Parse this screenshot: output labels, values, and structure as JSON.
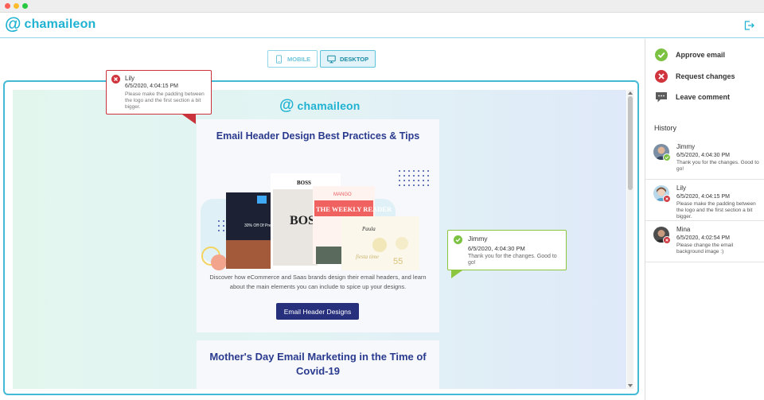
{
  "app": {
    "logo_symbol": "@",
    "logo_text": "chamaileon",
    "brand_color": "#1fb2d2",
    "exit_icon": "logout-icon"
  },
  "view_toggle": {
    "mobile_label": "MOBILE",
    "desktop_label": "DESKTOP",
    "selected": "DESKTOP"
  },
  "preview": {
    "email_logo_symbol": "@",
    "email_logo_text": "chamaileon",
    "card1": {
      "title": "Email Header Design Best Practices & Tips",
      "description": "Discover how eCommerce and Saas brands design their email headers, and learn about the main elements you can include to spice up your designs.",
      "button": "Email Header Designs",
      "collage": {
        "boss": "BOSS",
        "boss_big": "BOS",
        "mango": "MANGO",
        "weekly": "THE WEEKLY READER",
        "promo": "30% Off Of Premium Mem",
        "paula": "Paula",
        "fiesta": "fiesta time",
        "number": "55"
      }
    },
    "card2": {
      "title": "Mother's Day Email Marketing in the Time of Covid-19"
    }
  },
  "comments": {
    "lily": {
      "name": "Lily",
      "time": "6/5/2020, 4:04:15 PM",
      "message": "Please make the padding between the logo and the first section a bit bigger.",
      "status": "rejected",
      "color": "#c9343c"
    },
    "jimmy": {
      "name": "Jimmy",
      "time": "6/5/2020, 4:04:30 PM",
      "message": "Thank you for the changes. Good to go!",
      "status": "approved",
      "color": "#8cc63f"
    }
  },
  "sidebar": {
    "actions": [
      {
        "label": "Approve email",
        "icon": "check-circle-icon",
        "color": "#7cc242"
      },
      {
        "label": "Request changes",
        "icon": "x-circle-icon",
        "color": "#d0353d"
      },
      {
        "label": "Leave comment",
        "icon": "comment-icon",
        "color": "#5b5b5b"
      }
    ],
    "history_title": "History",
    "history": [
      {
        "name": "Jimmy",
        "time": "6/5/2020, 4:04:30 PM",
        "message": "Thank you for the changes. Good to go!",
        "status": "approved"
      },
      {
        "name": "Lily",
        "time": "6/5/2020, 4:04:15 PM",
        "message": "Please make the padding between the logo and the first section a bit bigger.",
        "status": "rejected"
      },
      {
        "name": "Mina",
        "time": "6/5/2020, 4:02:54 PM",
        "message": "Please change the email background image :)",
        "status": "rejected"
      }
    ]
  }
}
